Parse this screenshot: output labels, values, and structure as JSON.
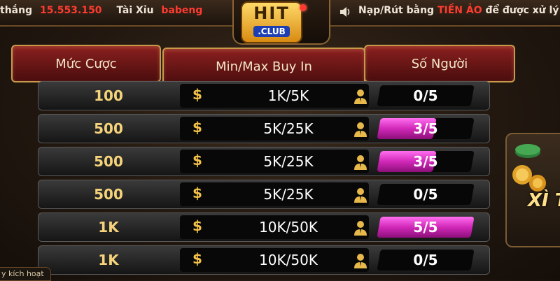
{
  "ticker": {
    "win_word": "thắng",
    "win_amount": "15.553.150",
    "game": "Tài Xỉu",
    "user": "babeng",
    "notice_prefix": "Nạp/Rút bằng ",
    "notice_highlight": "TIỀN ẢO",
    "notice_suffix": " để được xử lý nha"
  },
  "logo": {
    "main": "HIT",
    "sub": ".CLUB"
  },
  "headers": {
    "bet": "Mức Cược",
    "buyin": "Min/Max Buy In",
    "players": "Số Người"
  },
  "rows": [
    {
      "bet": "100",
      "buyin": "1K/5K",
      "players": "0/5",
      "fill": 0
    },
    {
      "bet": "500",
      "buyin": "5K/25K",
      "players": "3/5",
      "fill": 0.6
    },
    {
      "bet": "500",
      "buyin": "5K/25K",
      "players": "3/5",
      "fill": 0.6
    },
    {
      "bet": "500",
      "buyin": "5K/25K",
      "players": "0/5",
      "fill": 0
    },
    {
      "bet": "1K",
      "buyin": "10K/50K",
      "players": "5/5",
      "fill": 1
    },
    {
      "bet": "1K",
      "buyin": "10K/50K",
      "players": "0/5",
      "fill": 0
    }
  ],
  "side_card": {
    "label": "XÌ T"
  },
  "activate": {
    "label": "y kích hoạt"
  },
  "icons": {
    "currency": "$",
    "player": "person-icon",
    "sound": "speaker-icon"
  },
  "colors": {
    "accent_gold": "#f5d37a",
    "fill_magenta": "#d128b8",
    "ticker_red": "#ff3b30"
  }
}
